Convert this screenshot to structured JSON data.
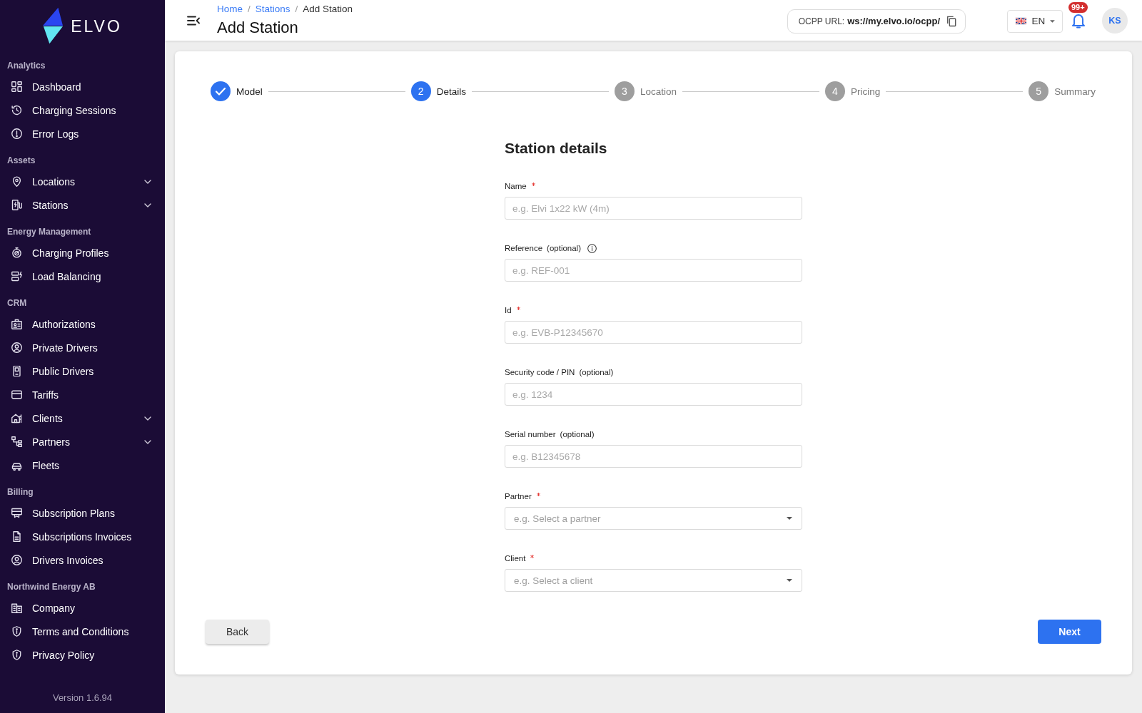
{
  "sidebar": {
    "logo": "ELVO",
    "sections": [
      {
        "title": "Analytics",
        "items": [
          {
            "label": "Dashboard",
            "expandable": false
          },
          {
            "label": "Charging Sessions",
            "expandable": false
          },
          {
            "label": "Error Logs",
            "expandable": false
          }
        ]
      },
      {
        "title": "Assets",
        "items": [
          {
            "label": "Locations",
            "expandable": true
          },
          {
            "label": "Stations",
            "expandable": true
          }
        ]
      },
      {
        "title": "Energy Management",
        "items": [
          {
            "label": "Charging Profiles",
            "expandable": false
          },
          {
            "label": "Load Balancing",
            "expandable": false
          }
        ]
      },
      {
        "title": "CRM",
        "items": [
          {
            "label": "Authorizations",
            "expandable": false
          },
          {
            "label": "Private Drivers",
            "expandable": false
          },
          {
            "label": "Public Drivers",
            "expandable": false
          },
          {
            "label": "Tariffs",
            "expandable": false
          },
          {
            "label": "Clients",
            "expandable": true
          },
          {
            "label": "Partners",
            "expandable": true
          },
          {
            "label": "Fleets",
            "expandable": false
          }
        ]
      },
      {
        "title": "Billing",
        "items": [
          {
            "label": "Subscription Plans",
            "expandable": false
          },
          {
            "label": "Subscriptions Invoices",
            "expandable": false
          },
          {
            "label": "Drivers Invoices",
            "expandable": false
          }
        ]
      },
      {
        "title": "Northwind Energy AB",
        "items": [
          {
            "label": "Company",
            "expandable": false
          },
          {
            "label": "Terms and Conditions",
            "expandable": false
          },
          {
            "label": "Privacy Policy",
            "expandable": false
          }
        ]
      }
    ],
    "version": "Version 1.6.94"
  },
  "header": {
    "breadcrumb": [
      {
        "label": "Home",
        "current": false,
        "separator": "/"
      },
      {
        "label": "Stations",
        "current": false,
        "separator": "/"
      },
      {
        "label": "Add Station",
        "current": true
      }
    ],
    "title": "Add Station",
    "ocpp_url": {
      "label": "OCPP URL:",
      "value": "ws://my.elvo.io/ocpp/"
    },
    "language": "EN",
    "notifications_badge": "99+",
    "avatar_initials": "KS"
  },
  "stepper": {
    "steps": [
      {
        "label": "Model",
        "completed": true,
        "selected": false
      },
      {
        "number": "2",
        "label": "Details",
        "completed": false,
        "selected": true
      },
      {
        "number": "3",
        "label": "Location",
        "completed": false,
        "selected": false
      },
      {
        "number": "4",
        "label": "Pricing",
        "completed": false,
        "selected": false
      },
      {
        "number": "5",
        "label": "Summary",
        "completed": false,
        "selected": false
      }
    ]
  },
  "form": {
    "title": "Station details",
    "fields": [
      {
        "kind": "text",
        "label": "Name",
        "required": true,
        "info": false,
        "placeholder": "e.g. Elvi 1x22 kW (4m)"
      },
      {
        "kind": "text",
        "label": "Reference",
        "note": "(optional)",
        "required": false,
        "info": true,
        "placeholder": "e.g. REF-001"
      },
      {
        "kind": "text",
        "label": "Id",
        "required": true,
        "info": false,
        "placeholder": "e.g. EVB-P12345670"
      },
      {
        "kind": "text",
        "label": "Security code / PIN",
        "note": "(optional)",
        "required": false,
        "info": false,
        "placeholder": "e.g. 1234"
      },
      {
        "kind": "text",
        "label": "Serial number",
        "note": "(optional)",
        "required": false,
        "info": false,
        "placeholder": "e.g. B12345678"
      },
      {
        "kind": "select",
        "label": "Partner",
        "required": true,
        "info": false,
        "placeholder": "e.g. Select a partner"
      },
      {
        "kind": "select",
        "label": "Client",
        "required": true,
        "info": false,
        "placeholder": "e.g. Select a client"
      }
    ]
  },
  "actions": {
    "back": "Back",
    "next": "Next"
  }
}
